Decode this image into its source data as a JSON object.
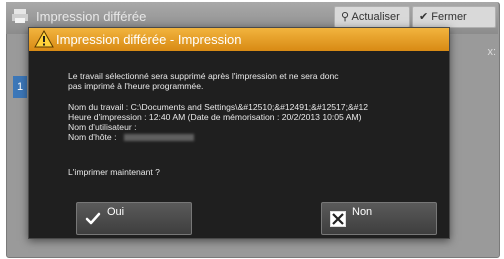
{
  "background_window": {
    "title": "Impression différée",
    "buttons": {
      "refresh": "Actualiser",
      "close": "Fermer"
    },
    "side_tab_text": "1",
    "right_text": "x:"
  },
  "dialog": {
    "title": "Impression différée - Impression",
    "message_line1": "Le travail sélectionné sera supprimé après l'impression et ne sera donc",
    "message_line2": "pas imprimé à l'heure programmée.",
    "job_name": "Nom du travail : C:\\Documents and Settings\\&#12510;&#12491;&#12517;&#12",
    "print_time": "Heure d'impression : 12:40 AM (Date de mémorisation : 20/2/2013 10:05 AM)",
    "user_name": "Nom d'utilisateur :",
    "host_name": "Nom d'hôte :",
    "question": "L'imprimer maintenant ?",
    "buttons": {
      "yes": "Oui",
      "no": "Non"
    }
  },
  "colors": {
    "title_bar": "#e49a22",
    "dialog_bg": "#1f1f1f",
    "button_bg": "#4b4b4b"
  },
  "icons": {
    "warning": "warning-icon",
    "yes": "checkmark-icon",
    "no": "close-icon",
    "app": "printer-icon"
  }
}
